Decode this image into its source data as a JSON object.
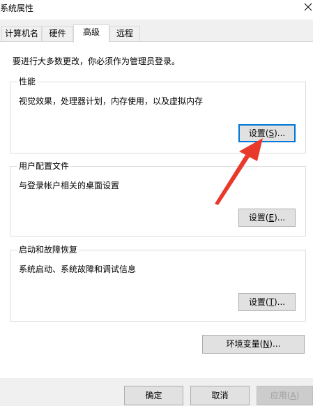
{
  "window": {
    "title": "系统属性"
  },
  "tabs": [
    {
      "label": "计算机名",
      "active": false
    },
    {
      "label": "硬件",
      "active": false
    },
    {
      "label": "高级",
      "active": true
    },
    {
      "label": "远程",
      "active": false
    }
  ],
  "advanced": {
    "intro": "要进行大多数更改，你必须作为管理员登录。",
    "performance": {
      "label": "性能",
      "description": "视觉效果，处理器计划，内存使用，以及虚拟内存",
      "button": {
        "prefix": "设置(",
        "key": "S",
        "suffix": ")..."
      }
    },
    "user_profiles": {
      "label": "用户配置文件",
      "description": "与登录帐户相关的桌面设置",
      "button": {
        "prefix": "设置(",
        "key": "E",
        "suffix": ")..."
      }
    },
    "startup_recovery": {
      "label": "启动和故障恢复",
      "description": "系统启动、系统故障和调试信息",
      "button": {
        "prefix": "设置(",
        "key": "T",
        "suffix": ")..."
      }
    },
    "env_vars": {
      "prefix": "环境变量(",
      "key": "N",
      "suffix": ")..."
    }
  },
  "footer": {
    "ok": "确定",
    "cancel": "取消",
    "apply": {
      "prefix": "应用(",
      "key": "A",
      "suffix": ")"
    }
  },
  "colors": {
    "annotation_arrow": "#e8392b",
    "focus_border": "#0078d7"
  },
  "icons": {
    "close": "close-icon",
    "annotation": "red-arrow-annotation"
  }
}
